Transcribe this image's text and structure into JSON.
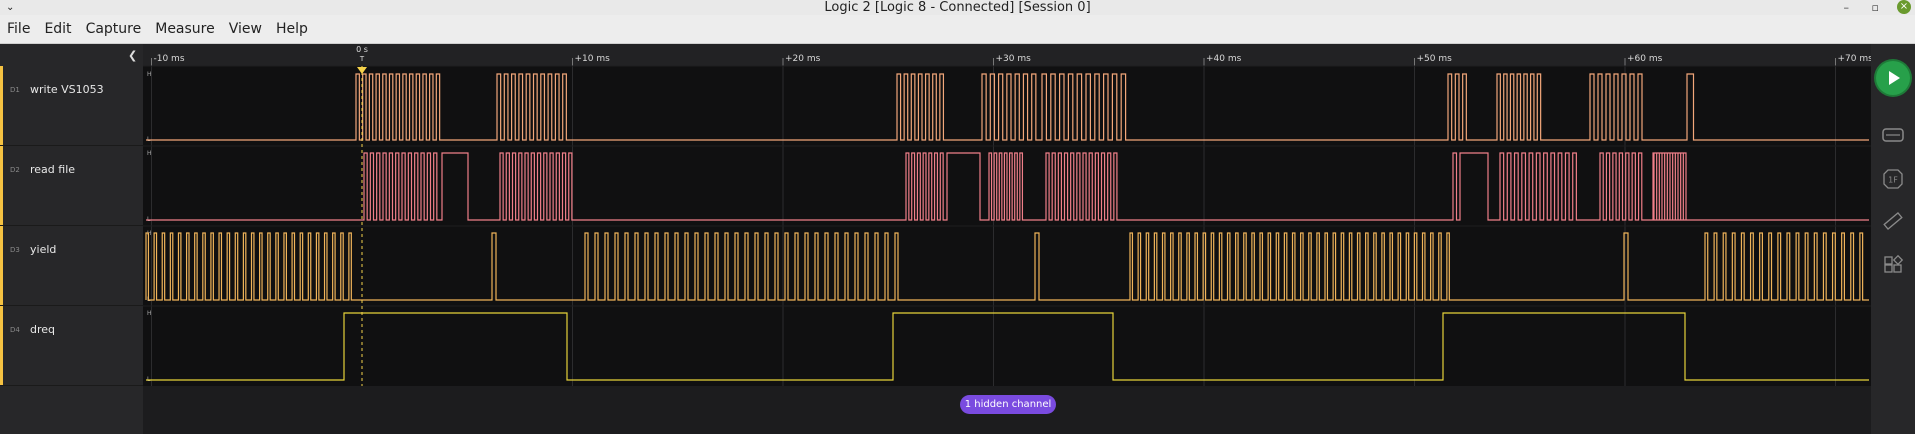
{
  "window": {
    "title": "Logic 2 [Logic 8 - Connected] [Session 0]",
    "close_glyph": "×"
  },
  "menu": [
    "File",
    "Edit",
    "Capture",
    "Measure",
    "View",
    "Help"
  ],
  "timeline": {
    "trigger_label": "0 s",
    "trigger_marker": "T",
    "ticks": [
      "-10 ms",
      "+10 ms",
      "+20 ms",
      "+30 ms",
      "+40 ms",
      "+50 ms",
      "+60 ms",
      "+70 ms"
    ],
    "tick_values_ms": [
      -10,
      10,
      20,
      30,
      40,
      50,
      60,
      70
    ]
  },
  "channels": [
    {
      "id": "D1",
      "name": "write VS1053",
      "color": "#f2a77a"
    },
    {
      "id": "D2",
      "name": "read file",
      "color": "#f07f89"
    },
    {
      "id": "D3",
      "name": "yield",
      "color": "#f0b45a"
    },
    {
      "id": "D4",
      "name": "dreq",
      "color": "#e7d33a"
    }
  ],
  "level_labels": {
    "high": "H",
    "low": "L"
  },
  "hidden_channels_label": "1 hidden channel",
  "icons": {
    "collapse": "chevron-left-icon",
    "play": "play-icon",
    "annotations": "keyboard-icon",
    "analyzers": "1f-icon",
    "measure": "ruler-icon",
    "extensions": "extensions-icon"
  },
  "colors": {
    "play": "#27a04a",
    "hidden_pill": "#7a4be0",
    "trigger": "#f5d24a"
  }
}
